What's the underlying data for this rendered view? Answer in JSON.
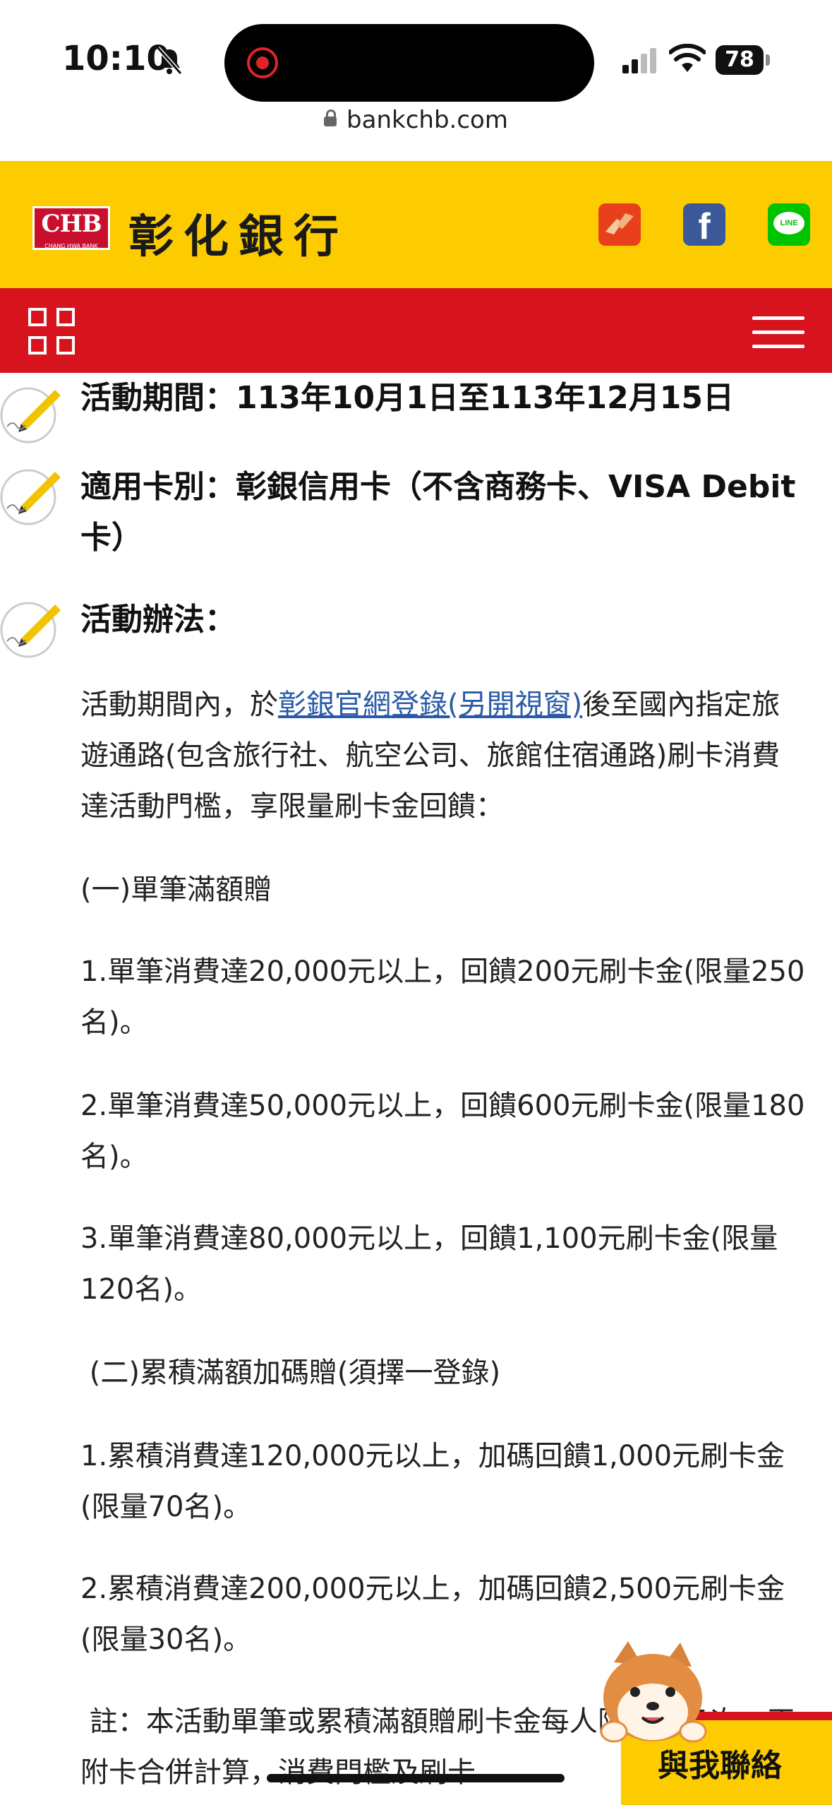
{
  "status_bar": {
    "time": "10:10",
    "battery": "78"
  },
  "url_bar": {
    "domain": "bankchb.com"
  },
  "brand": {
    "logo_text": "CHB",
    "logo_sub": "CHANG HWA BANK",
    "name": "彰化銀行"
  },
  "social": {
    "facebook_glyph": "f",
    "line_label": "LINE"
  },
  "sections": [
    {
      "label": "活動期間：113年10月1日至113年12月15日"
    },
    {
      "label": "適用卡別：彰銀信用卡（不含商務卡、VISA Debit卡）"
    },
    {
      "label": "活動辦法："
    }
  ],
  "body": {
    "intro_before": "活動期間內，於",
    "intro_link": "彰銀官網登錄(另開視窗)",
    "intro_after": "後至國內指定旅遊通路(包含旅行社、航空公司、旅館住宿通路)刷卡消費達活動門檻，享限量刷卡金回饋：",
    "group1": "(一)單筆滿額贈",
    "g1_item1": "1.單筆消費達20,000元以上，回饋200元刷卡金(限量250名)。",
    "g1_item2": "2.單筆消費達50,000元以上，回饋600元刷卡金(限量180名)。",
    "g1_item3": "3.單筆消費達80,000元以上，回饋1,100元刷卡金(限量120名)。",
    "group2": " (二)累積滿額加碼贈(須擇一登錄)",
    "g2_item1": "1.累積消費達120,000元以上，加碼回饋1,000元刷卡金 (限量70名)。",
    "g2_item2": "2.累積消費達200,000元以上，加碼回饋2,500元刷卡金(限量30名)。",
    "note": " 註：本活動單筆或累積滿額贈刷卡金每人限回饋乙次，正附卡合併計算，消費門檻及刷卡"
  },
  "contact": {
    "label": "與我聯絡"
  },
  "colors": {
    "brand_yellow": "#fccc00",
    "brand_red": "#d7141d",
    "link_blue": "#2a5ba8"
  }
}
